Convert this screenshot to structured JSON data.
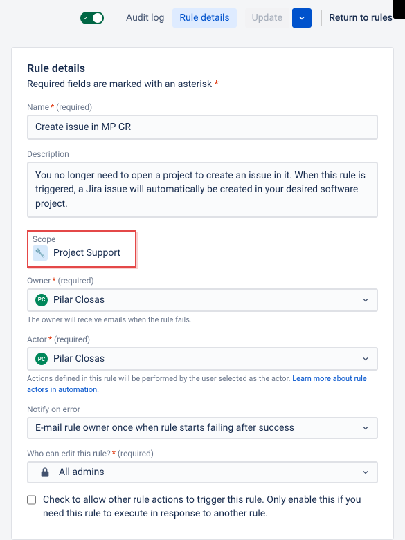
{
  "topbar": {
    "audit_log": "Audit log",
    "rule_details": "Rule details",
    "update": "Update",
    "return": "Return to rules"
  },
  "panel": {
    "title": "Rule details",
    "required_note": "Required fields are marked with an asterisk"
  },
  "name": {
    "label": "Name",
    "required_paren": "(required)",
    "value": "Create issue in MP GR"
  },
  "description": {
    "label": "Description",
    "value": "You no longer need to open a project to create an issue in it. When this rule is triggered, a Jira issue will automatically be created in your desired software project."
  },
  "scope": {
    "label": "Scope",
    "value": "Project Support"
  },
  "owner": {
    "label": "Owner",
    "required_paren": "(required)",
    "value": "Pilar Closas",
    "initials": "PC",
    "helper": "The owner will receive emails when the rule fails."
  },
  "actor": {
    "label": "Actor",
    "required_paren": "(required)",
    "value": "Pilar Closas",
    "initials": "PC",
    "helper_prefix": "Actions defined in this rule will be performed by the user selected as the actor. ",
    "helper_link": "Learn more about rule actors in automation."
  },
  "notify": {
    "label": "Notify on error",
    "value": "E-mail rule owner once when rule starts failing after success"
  },
  "edit": {
    "label": "Who can edit this rule?",
    "required_paren": "(required)",
    "value": "All admins"
  },
  "checkbox": {
    "label": "Check to allow other rule actions to trigger this rule. Only enable this if you need this rule to execute in response to another rule."
  }
}
